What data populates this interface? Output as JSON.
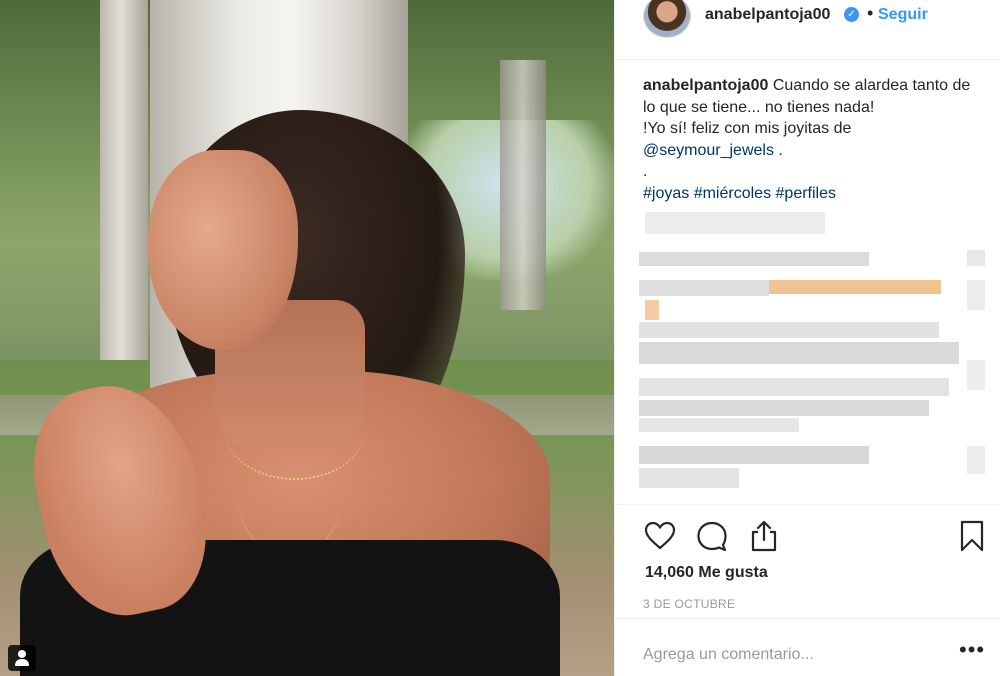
{
  "post": {
    "username": "anabelpantoja00",
    "verified_icon": "verified-badge-icon",
    "separator": "•",
    "follow_label": "Seguir",
    "caption": {
      "username": "anabelpantoja00",
      "line1": "Cuando se alardea tanto de lo que se tiene... no tienes nada!",
      "line2": "!Yo sí! feliz con mis joyitas de",
      "mention": "@seymour_jewels",
      "mention_suffix": " .",
      "dot": ".",
      "hashtags": [
        "#joyas",
        "#miércoles",
        "#perfiles"
      ]
    },
    "likes": "14,060 Me gusta",
    "date": "3 DE OCTUBRE",
    "comment_placeholder": "Agrega un comentario...",
    "more_label": "•••"
  },
  "icons": {
    "like": "heart-icon",
    "comment": "comment-bubble-icon",
    "share": "share-icon",
    "save": "bookmark-icon",
    "tag": "user-tag-icon"
  },
  "colors": {
    "link": "#003569",
    "follow": "#3897f0",
    "text": "#262626",
    "muted": "#999999",
    "border": "#efefef"
  }
}
